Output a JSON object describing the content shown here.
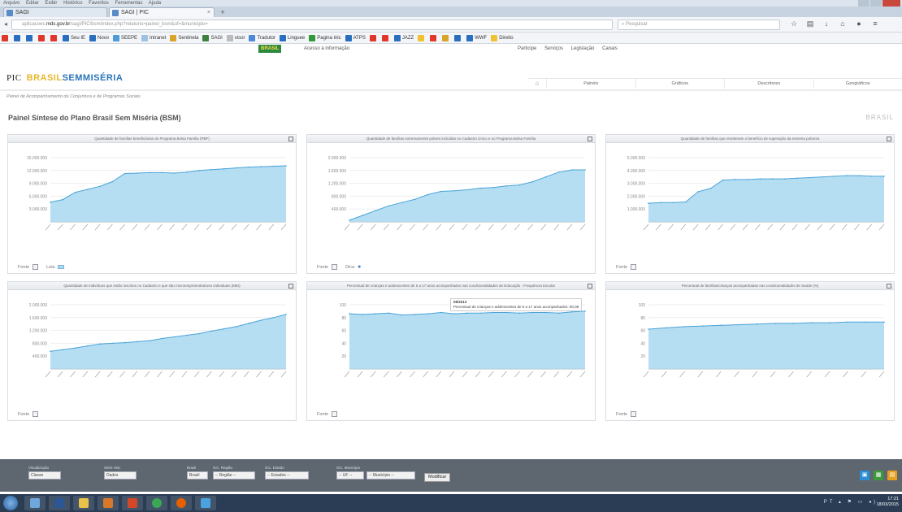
{
  "browser": {
    "menu": [
      "Arquivo",
      "Editar",
      "Exibir",
      "Histórico",
      "Favoritos",
      "Ferramentas",
      "Ajuda"
    ],
    "tabs": [
      {
        "label": "SAGI",
        "active": false
      },
      {
        "label": "SAGI | PIC",
        "active": true
      }
    ],
    "url_prefix": "aplicacoes.",
    "url_domain": "mds.gov.br",
    "url_rest": "/sagi/PIC/bsm/index.php?relatorio=painel_bsm&uf=&municipio=",
    "search_placeholder": "Pesquisar"
  },
  "bookmarks": [
    {
      "label": "",
      "color": "#e0362c"
    },
    {
      "label": "",
      "color": "#2a6fbf"
    },
    {
      "label": "",
      "color": "#2a6fbf"
    },
    {
      "label": "",
      "color": "#e0362c"
    },
    {
      "label": "",
      "color": "#e0362c"
    },
    {
      "label": "Seu IE",
      "color": "#2a6fbf"
    },
    {
      "label": "Novo",
      "color": "#2a6fbf"
    },
    {
      "label": "SEEPE",
      "color": "#4f9bd8"
    },
    {
      "label": "Intranet",
      "color": "#9dc0e3"
    },
    {
      "label": "Sentinela",
      "color": "#d8a52a"
    },
    {
      "label": "SAGI",
      "color": "#3e7f3f"
    },
    {
      "label": "visor",
      "color": "#bbbbbb"
    },
    {
      "label": "Tradutor",
      "color": "#4c8ad8"
    },
    {
      "label": "Linguee",
      "color": "#2a6fbf"
    },
    {
      "label": "Pagina inic",
      "color": "#2e9a3c"
    },
    {
      "label": "ATPS",
      "color": "#2a6fbf"
    },
    {
      "label": "",
      "color": "#e0362c"
    },
    {
      "label": "",
      "color": "#e0362c"
    },
    {
      "label": "JAZZ",
      "color": "#2a6fbf"
    },
    {
      "label": "",
      "color": "#f0c230"
    },
    {
      "label": "",
      "color": "#e0362c"
    },
    {
      "label": "",
      "color": "#d8a52a"
    },
    {
      "label": "",
      "color": "#2a6fbf"
    },
    {
      "label": "WWF",
      "color": "#2a6fbf"
    },
    {
      "label": "Direito",
      "color": "#f0c230"
    }
  ],
  "govbar": {
    "brasil": "BRASIL",
    "acesso": "Acesso à informação",
    "links": [
      "Participe",
      "Serviços",
      "Legislação",
      "Canais"
    ]
  },
  "app": {
    "logo_prefix": "PIC",
    "logo_brasil": "BRASIL",
    "logo_sem": "SEM",
    "logo_miseria": "MISÉRIA",
    "subtitle": "Painel de Acompanhamento da Conjuntura e de Programas Sociais",
    "nav": [
      "Painéis",
      "Gráficos",
      "Descritores",
      "Geográficos"
    ]
  },
  "page": {
    "title": "Painel Síntese do Plano Brasil Sem Miséria (BSM)",
    "region": "BRASIL"
  },
  "panels": [
    {
      "title": "Quantidade de famílias beneficiárias do Programa Bolsa Família (PBF)",
      "footer": "Fonte",
      "legend2": "Leia"
    },
    {
      "title": "Quantidade de famílias extremamente pobres incluídas no Cadastro Único e no Programa Bolsa Família",
      "footer": "Fonte",
      "legend2": "Dica"
    },
    {
      "title": "Quantidade de famílias que receberam o benefício de superação da extrema pobreza",
      "footer": "Fonte"
    },
    {
      "title": "Quantidade de indivíduos que estão inscritos no Cadastro e que são microempreendedores individuais (MEI)",
      "footer": "Fonte"
    },
    {
      "title": "Percentual de crianças e adolescentes de 6 a 17 anos acompanhados nas condicionalidades de Educação - Frequência Escolar",
      "footer": "Fonte",
      "tooltip_title": "08/2013",
      "tooltip_text": "Percentual de crianças e adolescentes de 6 a 17 anos acompanhados: 90,08"
    },
    {
      "title": "Percentual de famílias/crianças acompanhadas nas condicionalidades de Saúde (%)",
      "footer": "Fonte"
    }
  ],
  "chart_data": [
    {
      "type": "area",
      "y": [
        4.6,
        5.2,
        6.9,
        7.6,
        8.3,
        9.4,
        11.3,
        11.4,
        11.5,
        11.5,
        11.4,
        11.6,
        12.0,
        12.2,
        12.4,
        12.6,
        12.8,
        12.9,
        13.0,
        13.1
      ],
      "ylim": [
        0,
        15
      ],
      "ytick_labels": [
        "3.000.000",
        "6.000.000",
        "9.000.000",
        "12.000.000",
        "15.000.000"
      ],
      "ytick_values": [
        3,
        6,
        9,
        12,
        15
      ],
      "color": "#a9d8f0"
    },
    {
      "type": "area",
      "y": [
        0.05,
        0.2,
        0.35,
        0.5,
        0.6,
        0.7,
        0.85,
        0.95,
        0.97,
        1.0,
        1.05,
        1.07,
        1.12,
        1.15,
        1.25,
        1.4,
        1.55,
        1.62,
        1.62
      ],
      "ylim": [
        0,
        2.0
      ],
      "ytick_labels": [
        "400.000",
        "800.000",
        "1.200.000",
        "1.600.000",
        "2.000.000"
      ],
      "ytick_values": [
        0.4,
        0.8,
        1.2,
        1.6,
        2.0
      ],
      "color": "#a9d8f0"
    },
    {
      "type": "area",
      "y": [
        1.45,
        1.5,
        1.5,
        1.55,
        2.35,
        2.6,
        3.25,
        3.3,
        3.3,
        3.35,
        3.35,
        3.35,
        3.4,
        3.45,
        3.5,
        3.55,
        3.6,
        3.6,
        3.55,
        3.55
      ],
      "ylim": [
        0,
        5
      ],
      "ytick_labels": [
        "1.000.000",
        "2.000.000",
        "3.000.000",
        "4.000.000",
        "5.000.000"
      ],
      "ytick_values": [
        1,
        2,
        3,
        4,
        5
      ],
      "color": "#a9d8f0"
    },
    {
      "type": "area",
      "y": [
        0.55,
        0.6,
        0.65,
        0.72,
        0.78,
        0.8,
        0.82,
        0.85,
        0.88,
        0.95,
        1.0,
        1.05,
        1.1,
        1.18,
        1.25,
        1.32,
        1.42,
        1.52,
        1.6,
        1.7
      ],
      "ylim": [
        0,
        2.0
      ],
      "ytick_labels": [
        "400.000",
        "800.000",
        "1.200.000",
        "1.600.000",
        "2.000.000"
      ],
      "ytick_values": [
        0.4,
        0.8,
        1.2,
        1.6,
        2.0
      ],
      "color": "#a9d8f0"
    },
    {
      "type": "area",
      "y": [
        86,
        85,
        86,
        87,
        84,
        85,
        86,
        88,
        86,
        87,
        87,
        88,
        88,
        87,
        88,
        88,
        87,
        89,
        90
      ],
      "ylim": [
        0,
        100
      ],
      "ytick_labels": [
        "20",
        "40",
        "60",
        "80",
        "100"
      ],
      "ytick_values": [
        20,
        40,
        60,
        80,
        100
      ],
      "color": "#a9d8f0"
    },
    {
      "type": "area",
      "y": [
        62,
        64,
        66,
        67,
        68,
        69,
        70,
        71,
        71,
        72,
        72,
        73,
        73,
        73
      ],
      "ylim": [
        0,
        100
      ],
      "ytick_labels": [
        "20",
        "40",
        "60",
        "80",
        "100"
      ],
      "ytick_values": [
        20,
        40,
        60,
        80,
        100
      ],
      "color": "#a9d8f0"
    }
  ],
  "filters": [
    {
      "label": "Visualização",
      "value": "Classe"
    },
    {
      "label": "Série Hist.",
      "value": "Dados"
    },
    {
      "label": "Brasil",
      "value": "Brasil"
    },
    {
      "label": "Grc. Região",
      "value": "-- Região --"
    },
    {
      "label": "Grc. Estado",
      "value": "-- Estados --"
    },
    {
      "label": "Grc. Município",
      "value": "-- UF --"
    },
    {
      "label": "",
      "value": "-- Município --"
    }
  ],
  "filter_button": "Modificar",
  "taskbar": {
    "time": "17:21",
    "date": "18/03/2015",
    "tray": "PT"
  }
}
